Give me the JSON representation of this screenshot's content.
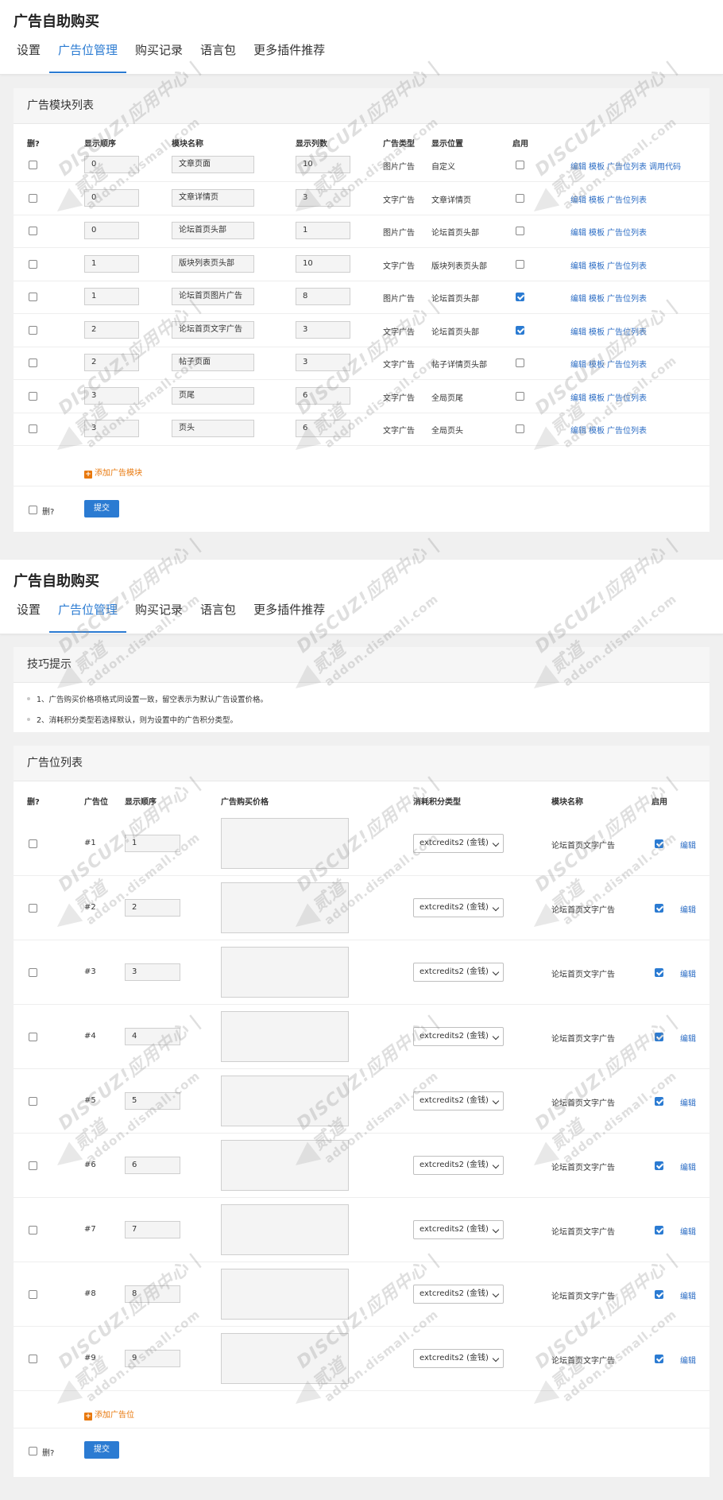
{
  "app_title": "广告自助购买",
  "tabs": [
    "设置",
    "广告位管理",
    "购买记录",
    "语言包",
    "更多插件推荐"
  ],
  "colors": {
    "accent": "#2b7bd2",
    "link": "#2b6cc4",
    "add": "#e8780c"
  },
  "watermark": {
    "line1": "DISCUZ!应用中心 | 贰道",
    "line2": "addon.dismall.com"
  },
  "module_list": {
    "title": "广告模块列表",
    "headers": [
      "删?",
      "显示顺序",
      "模块名称",
      "显示列数",
      "广告类型",
      "显示位置",
      "启用"
    ],
    "rows": [
      {
        "order": "0",
        "name": "文章页面",
        "cols": "10",
        "type": "图片广告",
        "pos": "自定义",
        "enabled": false,
        "links": [
          "编辑",
          "模板",
          "广告位列表",
          "调用代码"
        ]
      },
      {
        "order": "0",
        "name": "文章详情页",
        "cols": "3",
        "type": "文字广告",
        "pos": "文章详情页",
        "enabled": false,
        "links": [
          "编辑",
          "模板",
          "广告位列表"
        ]
      },
      {
        "order": "0",
        "name": "论坛首页头部",
        "cols": "1",
        "type": "图片广告",
        "pos": "论坛首页头部",
        "enabled": false,
        "links": [
          "编辑",
          "模板",
          "广告位列表"
        ]
      },
      {
        "order": "1",
        "name": "版块列表页头部",
        "cols": "10",
        "type": "文字广告",
        "pos": "版块列表页头部",
        "enabled": false,
        "links": [
          "编辑",
          "模板",
          "广告位列表"
        ]
      },
      {
        "order": "1",
        "name": "论坛首页图片广告",
        "cols": "8",
        "type": "图片广告",
        "pos": "论坛首页头部",
        "enabled": true,
        "links": [
          "编辑",
          "模板",
          "广告位列表"
        ]
      },
      {
        "order": "2",
        "name": "论坛首页文字广告",
        "cols": "3",
        "type": "文字广告",
        "pos": "论坛首页头部",
        "enabled": true,
        "links": [
          "编辑",
          "模板",
          "广告位列表"
        ]
      },
      {
        "order": "2",
        "name": "帖子页面",
        "cols": "3",
        "type": "文字广告",
        "pos": "帖子详情页头部",
        "enabled": false,
        "links": [
          "编辑",
          "模板",
          "广告位列表"
        ]
      },
      {
        "order": "3",
        "name": "页尾",
        "cols": "6",
        "type": "文字广告",
        "pos": "全局页尾",
        "enabled": false,
        "links": [
          "编辑",
          "模板",
          "广告位列表"
        ]
      },
      {
        "order": "3",
        "name": "页头",
        "cols": "6",
        "type": "文字广告",
        "pos": "全局页头",
        "enabled": false,
        "links": [
          "编辑",
          "模板",
          "广告位列表"
        ]
      }
    ],
    "add_label": "添加广告模块",
    "delete_label": "删?",
    "submit_label": "提交"
  },
  "tips": {
    "title": "技巧提示",
    "items": [
      "1、广告购买价格项格式同设置一致，留空表示为默认广告设置价格。",
      "2、消耗积分类型若选择默认，则为设置中的广告积分类型。"
    ]
  },
  "slot_list": {
    "title": "广告位列表",
    "headers": [
      "删?",
      "广告位",
      "显示顺序",
      "广告购买价格",
      "消耗积分类型",
      "模块名称",
      "启用"
    ],
    "rows": [
      {
        "id": "#1",
        "order": "1",
        "credit": "extcredits2 (金钱)",
        "module": "论坛首页文字广告",
        "enabled": true,
        "edit": "编辑"
      },
      {
        "id": "#2",
        "order": "2",
        "credit": "extcredits2 (金钱)",
        "module": "论坛首页文字广告",
        "enabled": true,
        "edit": "编辑"
      },
      {
        "id": "#3",
        "order": "3",
        "credit": "extcredits2 (金钱)",
        "module": "论坛首页文字广告",
        "enabled": true,
        "edit": "编辑"
      },
      {
        "id": "#4",
        "order": "4",
        "credit": "extcredits2 (金钱)",
        "module": "论坛首页文字广告",
        "enabled": true,
        "edit": "编辑"
      },
      {
        "id": "#5",
        "order": "5",
        "credit": "extcredits2 (金钱)",
        "module": "论坛首页文字广告",
        "enabled": true,
        "edit": "编辑"
      },
      {
        "id": "#6",
        "order": "6",
        "credit": "extcredits2 (金钱)",
        "module": "论坛首页文字广告",
        "enabled": true,
        "edit": "编辑"
      },
      {
        "id": "#7",
        "order": "7",
        "credit": "extcredits2 (金钱)",
        "module": "论坛首页文字广告",
        "enabled": true,
        "edit": "编辑"
      },
      {
        "id": "#8",
        "order": "8",
        "credit": "extcredits2 (金钱)",
        "module": "论坛首页文字广告",
        "enabled": true,
        "edit": "编辑"
      },
      {
        "id": "#9",
        "order": "9",
        "credit": "extcredits2 (金钱)",
        "module": "论坛首页文字广告",
        "enabled": true,
        "edit": "编辑"
      }
    ],
    "add_label": "添加广告位",
    "delete_label": "删?",
    "submit_label": "提交"
  }
}
